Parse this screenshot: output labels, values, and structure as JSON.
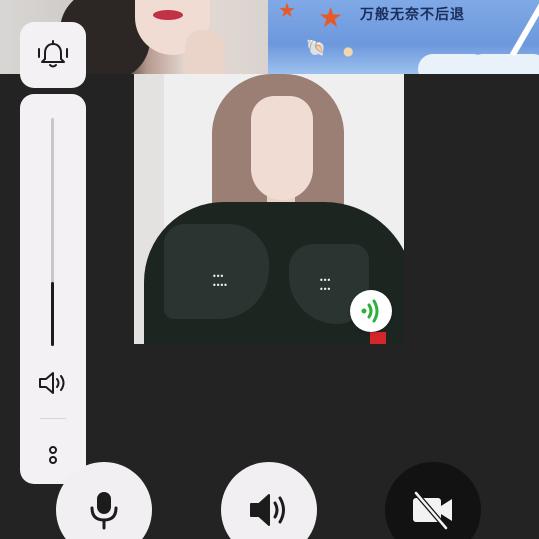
{
  "participants": {
    "top_left": {
      "kind": "camera-feed"
    },
    "top_right": {
      "kind": "shared-image",
      "banner_text": "万般无奈不后退"
    }
  },
  "main_video": {
    "speaking_indicator": "speaking-icon"
  },
  "side_panel": {
    "ring_mode_icon": "bell-vibrate-icon",
    "volume_level": 0.28,
    "volume_icon": "speaker-icon",
    "more_icon": "more-vertical-icon"
  },
  "controls": [
    {
      "id": "mic",
      "icon": "microphone-icon",
      "state": "on"
    },
    {
      "id": "speaker",
      "icon": "speaker-icon",
      "state": "on"
    },
    {
      "id": "camera",
      "icon": "camera-off-icon",
      "state": "off"
    }
  ],
  "colors": {
    "background": "#232323",
    "panel": "#f3f1f3",
    "speaking_green": "#2bb13a",
    "camera_off_bg": "#121212"
  }
}
